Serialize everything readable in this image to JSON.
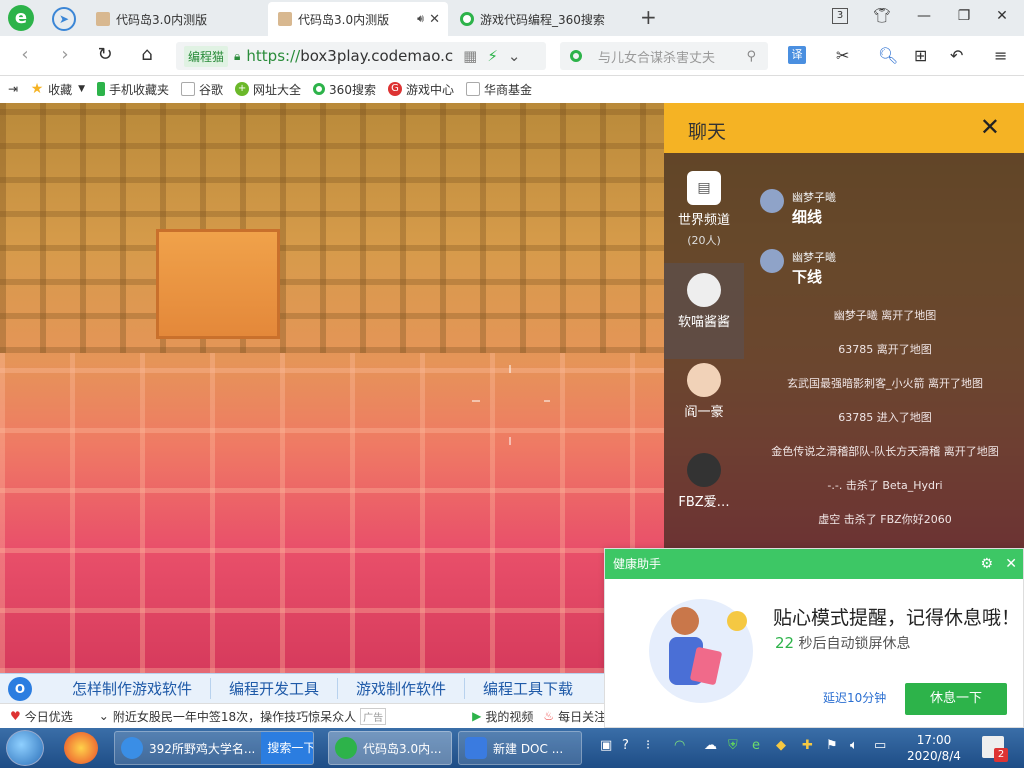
{
  "tabs": [
    {
      "title": "代码岛3.0内测版"
    },
    {
      "title": "代码岛3.0内测版"
    },
    {
      "title": "游戏代码编程_360搜索"
    }
  ],
  "tab_count": "3",
  "address": {
    "site_badge": "编程猫",
    "scheme": "https://",
    "host": "box3play.codemao.c",
    "search_placeholder": "与儿女合谋杀害丈夫"
  },
  "bookmarks": [
    {
      "label": "收藏"
    },
    {
      "label": "手机收藏夹"
    },
    {
      "label": "谷歌"
    },
    {
      "label": "网址大全"
    },
    {
      "label": "360搜索"
    },
    {
      "label": "游戏中心"
    },
    {
      "label": "华商基金"
    }
  ],
  "chat": {
    "title": "聊天",
    "channels": [
      {
        "name": "世界频道",
        "sub": "(20人)"
      },
      {
        "name": "软喵酱酱"
      },
      {
        "name": "阎一豪"
      },
      {
        "name": "FBZ爱…"
      }
    ],
    "messages": [
      {
        "user": "幽梦子曦",
        "text": "细线"
      },
      {
        "user": "幽梦子曦",
        "text": "下线"
      }
    ],
    "system": [
      "幽梦子曦 离开了地图",
      "63785 离开了地图",
      "玄武国最强暗影刺客_小火箭 离开了地图",
      "63785 进入了地图",
      "金色传说之滑稽部队-队长方天滑稽 离开了地图",
      "-.-. 击杀了 Beta_Hydri",
      "虚空 击杀了 FBZ你好2060"
    ]
  },
  "health": {
    "header": "健康助手",
    "title": "贴心模式提醒，记得休息哦！",
    "seconds": "22",
    "sub": "秒后自动锁屏休息",
    "delay": "延迟10分钟",
    "rest": "休息一下"
  },
  "suggestions": [
    "怎样制作游戏软件",
    "编程开发工具",
    "游戏制作软件",
    "编程工具下载"
  ],
  "news": {
    "today": "今日优选",
    "headline": "附近女股民一年中签18次，操作技巧惊呆众人",
    "ad": "广告",
    "video": "我的视频",
    "daily": "每日关注"
  },
  "taskbar": {
    "items": [
      {
        "label": "392所野鸡大学名..."
      },
      {
        "label": "代码岛3.0内..."
      },
      {
        "label": "新建 DOC ..."
      }
    ],
    "search_btn": "搜索一下",
    "time": "17:00",
    "date": "2020/8/4",
    "notif_count": "2"
  },
  "colors": {
    "chat_header": "#f5b324",
    "health_green": "#3dc765",
    "accent_blue": "#2b7de0"
  }
}
